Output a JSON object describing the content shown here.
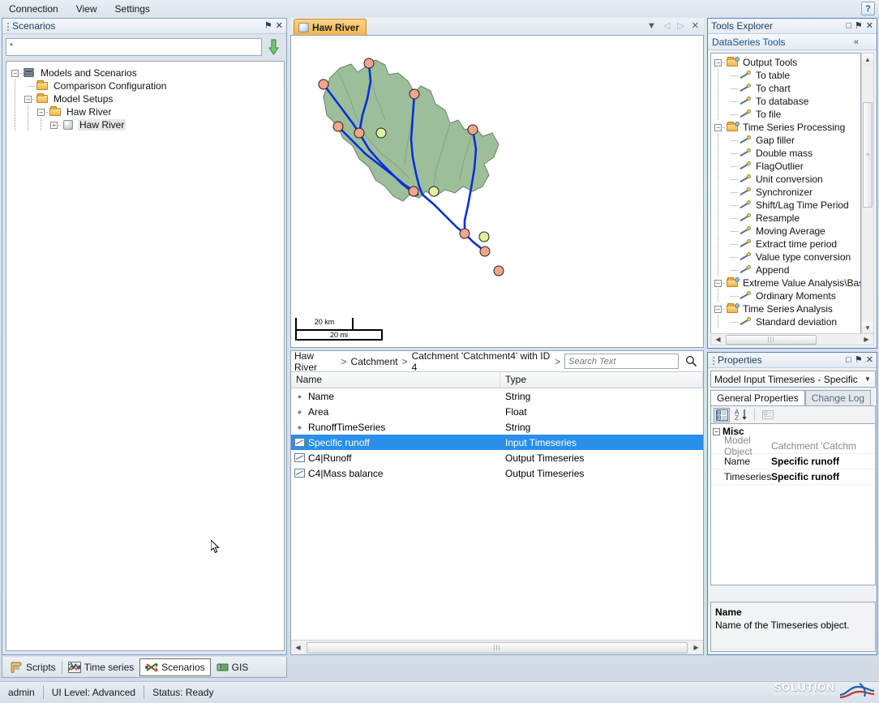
{
  "menu": {
    "items": [
      {
        "label": "Connection"
      },
      {
        "label": "View"
      },
      {
        "label": "Settings"
      }
    ],
    "help_label": "?"
  },
  "scenarios_panel": {
    "title": "Scenarios",
    "pin_glyph": "⚑",
    "close_glyph": "✕",
    "search_value": "*",
    "download_icon": "down-arrow-icon",
    "tree": [
      {
        "label": "Models and Scenarios",
        "icon": "database-icon",
        "depth": 0,
        "expander": "−"
      },
      {
        "label": "Comparison Configuration",
        "icon": "folder-icon",
        "depth": 1,
        "expander": ""
      },
      {
        "label": "Model Setups",
        "icon": "folder-icon",
        "depth": 1,
        "expander": "−"
      },
      {
        "label": "Haw River",
        "icon": "folder-icon",
        "depth": 2,
        "expander": "−"
      },
      {
        "label": "Haw River",
        "icon": "cube-icon",
        "depth": 3,
        "expander": "+",
        "selected": true
      }
    ]
  },
  "document": {
    "tab_label": "Haw River",
    "tab_icon": "cube-icon",
    "nav": {
      "menu_glyph": "▼",
      "prev_glyph": "◁",
      "next_glyph": "▷",
      "close_glyph": "✕"
    },
    "map": {
      "scale_km": "20 km",
      "scale_mi": "20 mi"
    }
  },
  "grid": {
    "breadcrumb": [
      {
        "label": "Haw River"
      },
      {
        "label": "Catchment"
      },
      {
        "label": "Catchment 'Catchment4' with ID 4"
      }
    ],
    "breadcrumb_sep": ">",
    "search_placeholder": "Search Text",
    "search_icon": "magnifier-icon",
    "columns": [
      "Name",
      "Type"
    ],
    "rows": [
      {
        "name": "Name",
        "type": "String",
        "icon": "attribute-dot-icon",
        "selected": false
      },
      {
        "name": "Area",
        "type": "Float",
        "icon": "attribute-dot-icon",
        "selected": false
      },
      {
        "name": "RunoffTimeSeries",
        "type": "String",
        "icon": "attribute-dot-icon",
        "selected": false
      },
      {
        "name": "Specific runoff",
        "type": "Input Timeseries",
        "icon": "timeseries-icon",
        "selected": true
      },
      {
        "name": "C4|Runoff",
        "type": "Output Timeseries",
        "icon": "timeseries-icon",
        "selected": false
      },
      {
        "name": "C4|Mass balance",
        "type": "Output Timeseries",
        "icon": "timeseries-icon",
        "selected": false
      }
    ],
    "selection_color": "#2a8fe8"
  },
  "tools_explorer": {
    "title": "Tools Explorer",
    "restore_glyph": "□",
    "pin_glyph": "⚑",
    "close_glyph": "✕",
    "section_title": "DataSeries Tools",
    "collapse_glyph": "«",
    "tree": [
      {
        "label": "Output Tools",
        "kind": "folder",
        "depth": 0,
        "expander": "−"
      },
      {
        "label": "To table",
        "kind": "tool",
        "depth": 1
      },
      {
        "label": "To chart",
        "kind": "tool",
        "depth": 1
      },
      {
        "label": "To database",
        "kind": "tool",
        "depth": 1
      },
      {
        "label": "To file",
        "kind": "tool",
        "depth": 1
      },
      {
        "label": "Time Series Processing",
        "kind": "folder",
        "depth": 0,
        "expander": "−"
      },
      {
        "label": "Gap filler",
        "kind": "tool",
        "depth": 1
      },
      {
        "label": "Double mass",
        "kind": "tool",
        "depth": 1
      },
      {
        "label": "FlagOutlier",
        "kind": "tool",
        "depth": 1
      },
      {
        "label": "Unit conversion",
        "kind": "tool",
        "depth": 1
      },
      {
        "label": "Synchronizer",
        "kind": "tool",
        "depth": 1
      },
      {
        "label": "Shift/Lag Time Period",
        "kind": "tool",
        "depth": 1
      },
      {
        "label": "Resample",
        "kind": "tool",
        "depth": 1
      },
      {
        "label": "Moving Average",
        "kind": "tool",
        "depth": 1
      },
      {
        "label": "Extract time period",
        "kind": "tool",
        "depth": 1
      },
      {
        "label": "Value type conversion",
        "kind": "tool",
        "depth": 1
      },
      {
        "label": "Append",
        "kind": "tool",
        "depth": 1
      },
      {
        "label": "Extreme Value Analysis\\Basi",
        "kind": "folder",
        "depth": 0,
        "expander": "−"
      },
      {
        "label": "Ordinary Moments",
        "kind": "tool",
        "depth": 1
      },
      {
        "label": "Time Series Analysis",
        "kind": "folder",
        "depth": 0,
        "expander": "−"
      },
      {
        "label": "Standard deviation",
        "kind": "tool",
        "depth": 1
      }
    ]
  },
  "properties_panel": {
    "title": "Properties",
    "restore_glyph": "□",
    "pin_glyph": "⚑",
    "close_glyph": "✕",
    "object_selector": "Model Input Timeseries - Specific",
    "dropdown_glyph": "▼",
    "tabs": [
      {
        "label": "General Properties",
        "active": true
      },
      {
        "label": "Change Log",
        "active": false
      }
    ],
    "toolbar": {
      "categorized_icon": "categorized-view-icon",
      "alphabetical_icon": "sort-alphabetical-icon",
      "pages_icon": "property-pages-icon"
    },
    "category": "Misc",
    "category_expander": "−",
    "rows": [
      {
        "key": "Model Object",
        "value": "Catchment 'Catchm",
        "dim": true
      },
      {
        "key": "Name",
        "value": "Specific runoff",
        "dim": false
      },
      {
        "key": "Timeseries",
        "value": "Specific runoff",
        "dim": false
      }
    ],
    "description": {
      "title": "Name",
      "text": "Name of the Timeseries object."
    }
  },
  "view_tabs": [
    {
      "label": "Scripts",
      "icon": "script-icon",
      "active": false
    },
    {
      "label": "Time series",
      "icon": "chart-icon",
      "active": false
    },
    {
      "label": "Scenarios",
      "icon": "scenarios-icon",
      "active": true
    },
    {
      "label": "GIS",
      "icon": "gis-icon",
      "active": false
    }
  ],
  "statusbar": {
    "user": "admin",
    "ui_level": "UI Level: Advanced",
    "status": "Status: Ready"
  },
  "branding": {
    "main": "SOLUTION",
    "sub": "SOFTWARE BY DHI"
  }
}
